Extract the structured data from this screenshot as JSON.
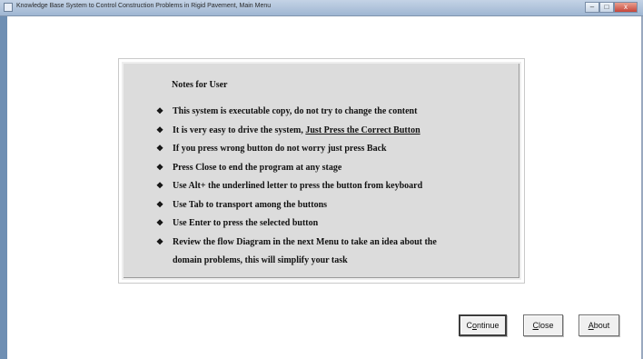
{
  "window": {
    "title": "Knowledge Base System to Control Construction Problems in Rigid Pavement, Main Menu",
    "controls": {
      "minimize": "–",
      "maximize": "□",
      "close": "x"
    }
  },
  "notes": {
    "title": "Notes for User",
    "bullet_symbol": "❖",
    "items": [
      {
        "text": "This system is executable copy, do not try to change the content"
      },
      {
        "text": "It is very easy to drive the system, ",
        "underlined": "Just Press the Correct Button"
      },
      {
        "text": "If you press wrong button do not worry just press Back"
      },
      {
        "text": "Press Close to end the program at any stage"
      },
      {
        "text": "Use Alt+ the underlined letter to press the button from keyboard"
      },
      {
        "text": "Use Tab to transport among the buttons"
      },
      {
        "text": "Use Enter to press the selected button"
      },
      {
        "text": "Review the flow Diagram in the next Menu to take an idea about the",
        "continuation": "domain problems, this will simplify your task"
      }
    ]
  },
  "buttons": {
    "continue": {
      "pre": "C",
      "accel": "o",
      "post": "ntinue"
    },
    "close": {
      "pre": "",
      "accel": "C",
      "post": "lose"
    },
    "about": {
      "pre": "",
      "accel": "A",
      "post": "bout"
    }
  }
}
